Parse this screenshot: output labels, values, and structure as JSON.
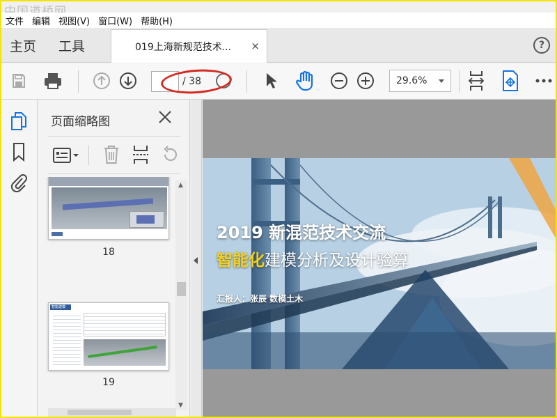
{
  "watermark": "中国道桥网",
  "menu": [
    "文件",
    "编辑",
    "视图(V)",
    "窗口(W)",
    "帮助(H)"
  ],
  "tabs": {
    "home": "主页",
    "tools": "工具",
    "document_title": "019上海新规范技术...",
    "close_glyph": "×",
    "help_glyph": "?"
  },
  "toolbar": {
    "current_page": "",
    "page_total": "/ 38",
    "zoom": "29.6%"
  },
  "sidebar": {
    "title": "页面缩略图",
    "close_glyph": "×"
  },
  "thumbnails": [
    {
      "page": "18",
      "footer_label": ""
    },
    {
      "page": "19",
      "header_label": "智能建模"
    }
  ],
  "slide": {
    "line1": "2019 新混范技术交流",
    "line2_highlight": "智能化",
    "line2_rest": "建模分析及设计验算",
    "reporter": "汇报人：张辰  数模土木"
  },
  "colors": {
    "highlight": "#f5d21a",
    "annotation_red": "#d42a20",
    "accent_blue": "#1473e6",
    "page_bg": "#f5e400"
  }
}
